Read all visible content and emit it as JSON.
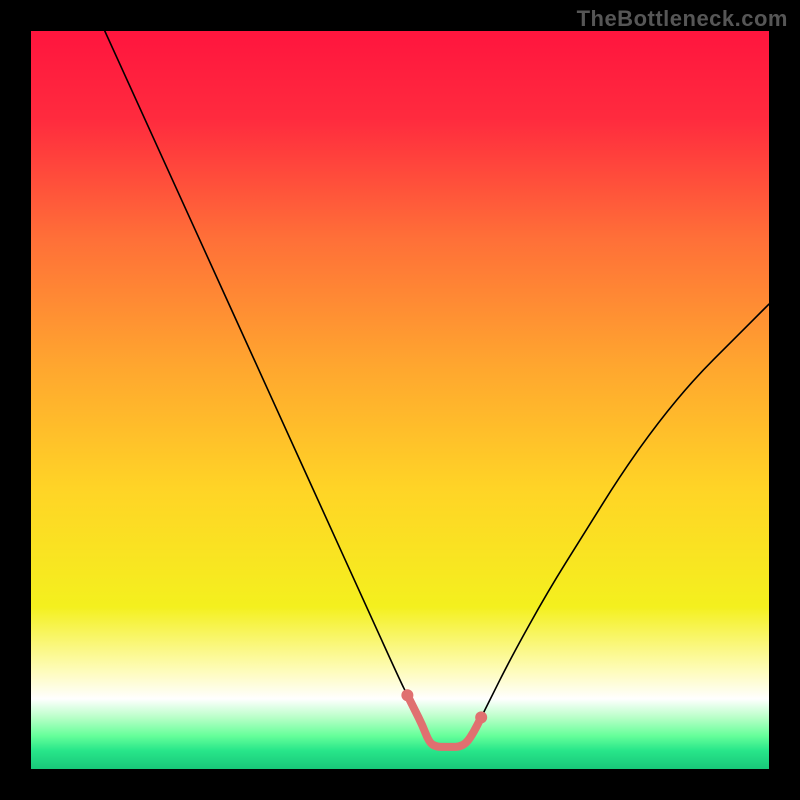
{
  "watermark": "TheBottleneck.com",
  "chart_data": {
    "type": "line",
    "title": "",
    "xlabel": "",
    "ylabel": "",
    "xlim": [
      0,
      100
    ],
    "ylim": [
      0,
      100
    ],
    "grid": false,
    "legend": false,
    "series": [
      {
        "name": "bottleneck-curve",
        "color": "#000000",
        "x": [
          10,
          15,
          20,
          25,
          30,
          35,
          40,
          45,
          50,
          51,
          52,
          53,
          54,
          55,
          56,
          57,
          58,
          59,
          60,
          61,
          62,
          65,
          70,
          75,
          80,
          85,
          90,
          95,
          100
        ],
        "values": [
          100,
          89,
          78,
          67,
          56,
          45,
          34,
          23,
          12,
          10,
          8,
          6,
          3.5,
          3,
          3,
          3,
          3,
          3.5,
          5,
          7,
          9,
          15,
          24,
          32,
          40,
          47,
          53,
          58,
          63
        ]
      },
      {
        "name": "bottom-highlight",
        "color": "#e07070",
        "x": [
          51,
          52,
          53,
          54,
          55,
          56,
          57,
          58,
          59,
          60,
          61
        ],
        "values": [
          10,
          8,
          6,
          3.5,
          3,
          3,
          3,
          3,
          3.5,
          5,
          7
        ]
      }
    ],
    "background_gradient": {
      "type": "vertical",
      "stops": [
        {
          "offset": 0.0,
          "color": "#ff153e"
        },
        {
          "offset": 0.12,
          "color": "#ff2b3e"
        },
        {
          "offset": 0.28,
          "color": "#ff6f38"
        },
        {
          "offset": 0.45,
          "color": "#ffa52f"
        },
        {
          "offset": 0.62,
          "color": "#ffd426"
        },
        {
          "offset": 0.78,
          "color": "#f4f01e"
        },
        {
          "offset": 0.86,
          "color": "#fdfbae"
        },
        {
          "offset": 0.905,
          "color": "#ffffff"
        },
        {
          "offset": 0.93,
          "color": "#b9ffc8"
        },
        {
          "offset": 0.955,
          "color": "#66ff9a"
        },
        {
          "offset": 0.975,
          "color": "#28e68a"
        },
        {
          "offset": 1.0,
          "color": "#18c779"
        }
      ]
    }
  }
}
